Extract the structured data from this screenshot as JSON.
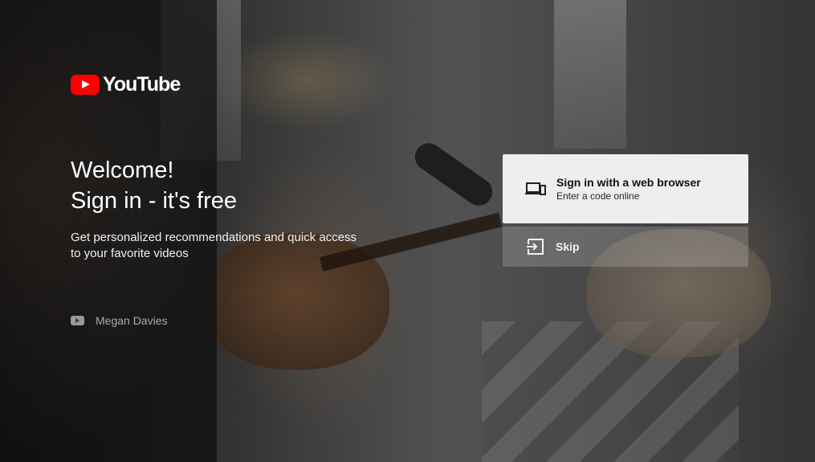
{
  "brand": {
    "name": "YouTube",
    "accent_color": "#ff0000"
  },
  "welcome": {
    "line1": "Welcome!",
    "line2": "Sign in - it's free",
    "description": "Get personalized recommendations and quick access to your favorite videos"
  },
  "account": {
    "icon": "youtube-small-icon",
    "name": "Megan Davies"
  },
  "actions": {
    "web_browser": {
      "icon": "devices-icon",
      "title": "Sign in with a web browser",
      "subtitle": "Enter a code online"
    },
    "skip": {
      "icon": "exit-icon",
      "title": "Skip"
    }
  }
}
